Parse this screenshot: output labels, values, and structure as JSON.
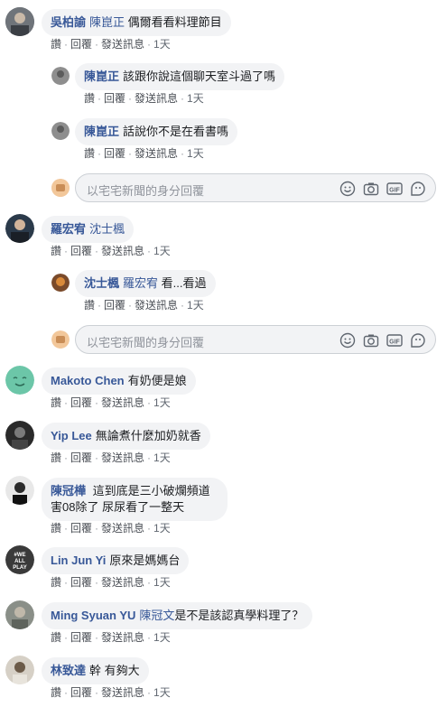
{
  "actions": {
    "like": "讚",
    "reply": "回覆",
    "message": "發送訊息",
    "time": "1天",
    "sep": "·"
  },
  "reply_placeholder": "以宅宅新聞的身分回覆",
  "comments": [
    {
      "name": "吳柏諭",
      "mention": "陳崑正",
      "text": "偶爾看看料理節目"
    },
    {
      "name": "陳崑正",
      "mention": "",
      "text": "該跟你說這個聊天室斗過了嗎"
    },
    {
      "name": "陳崑正",
      "mention": "",
      "text": "話說你不是在看書嗎"
    },
    {
      "name": "羅宏宥",
      "mention": "沈士楓",
      "text": ""
    },
    {
      "name": "沈士楓",
      "mention": "羅宏宥",
      "text": "看...看過"
    },
    {
      "name": "Makoto Chen",
      "mention": "",
      "text": "有奶便是娘"
    },
    {
      "name": "Yip Lee",
      "mention": "",
      "text": "無論煮什麼加奶就香"
    },
    {
      "name": "陳冠樺",
      "mention": "",
      "text": "這到底是三小破爛頻道",
      "text2": "害08除了 尿尿看了一整天"
    },
    {
      "name": "Lin Jun Yi",
      "mention": "",
      "text": "原來是媽媽台"
    },
    {
      "name": "Ming Syuan YU",
      "mention": "陳冠文",
      "text": "是不是該認真學料理了？"
    },
    {
      "name": "林致達",
      "mention": "",
      "text": "幹 有夠大"
    }
  ],
  "avatar_text": {
    "we_all_play": "#WE ALL PLAY"
  }
}
